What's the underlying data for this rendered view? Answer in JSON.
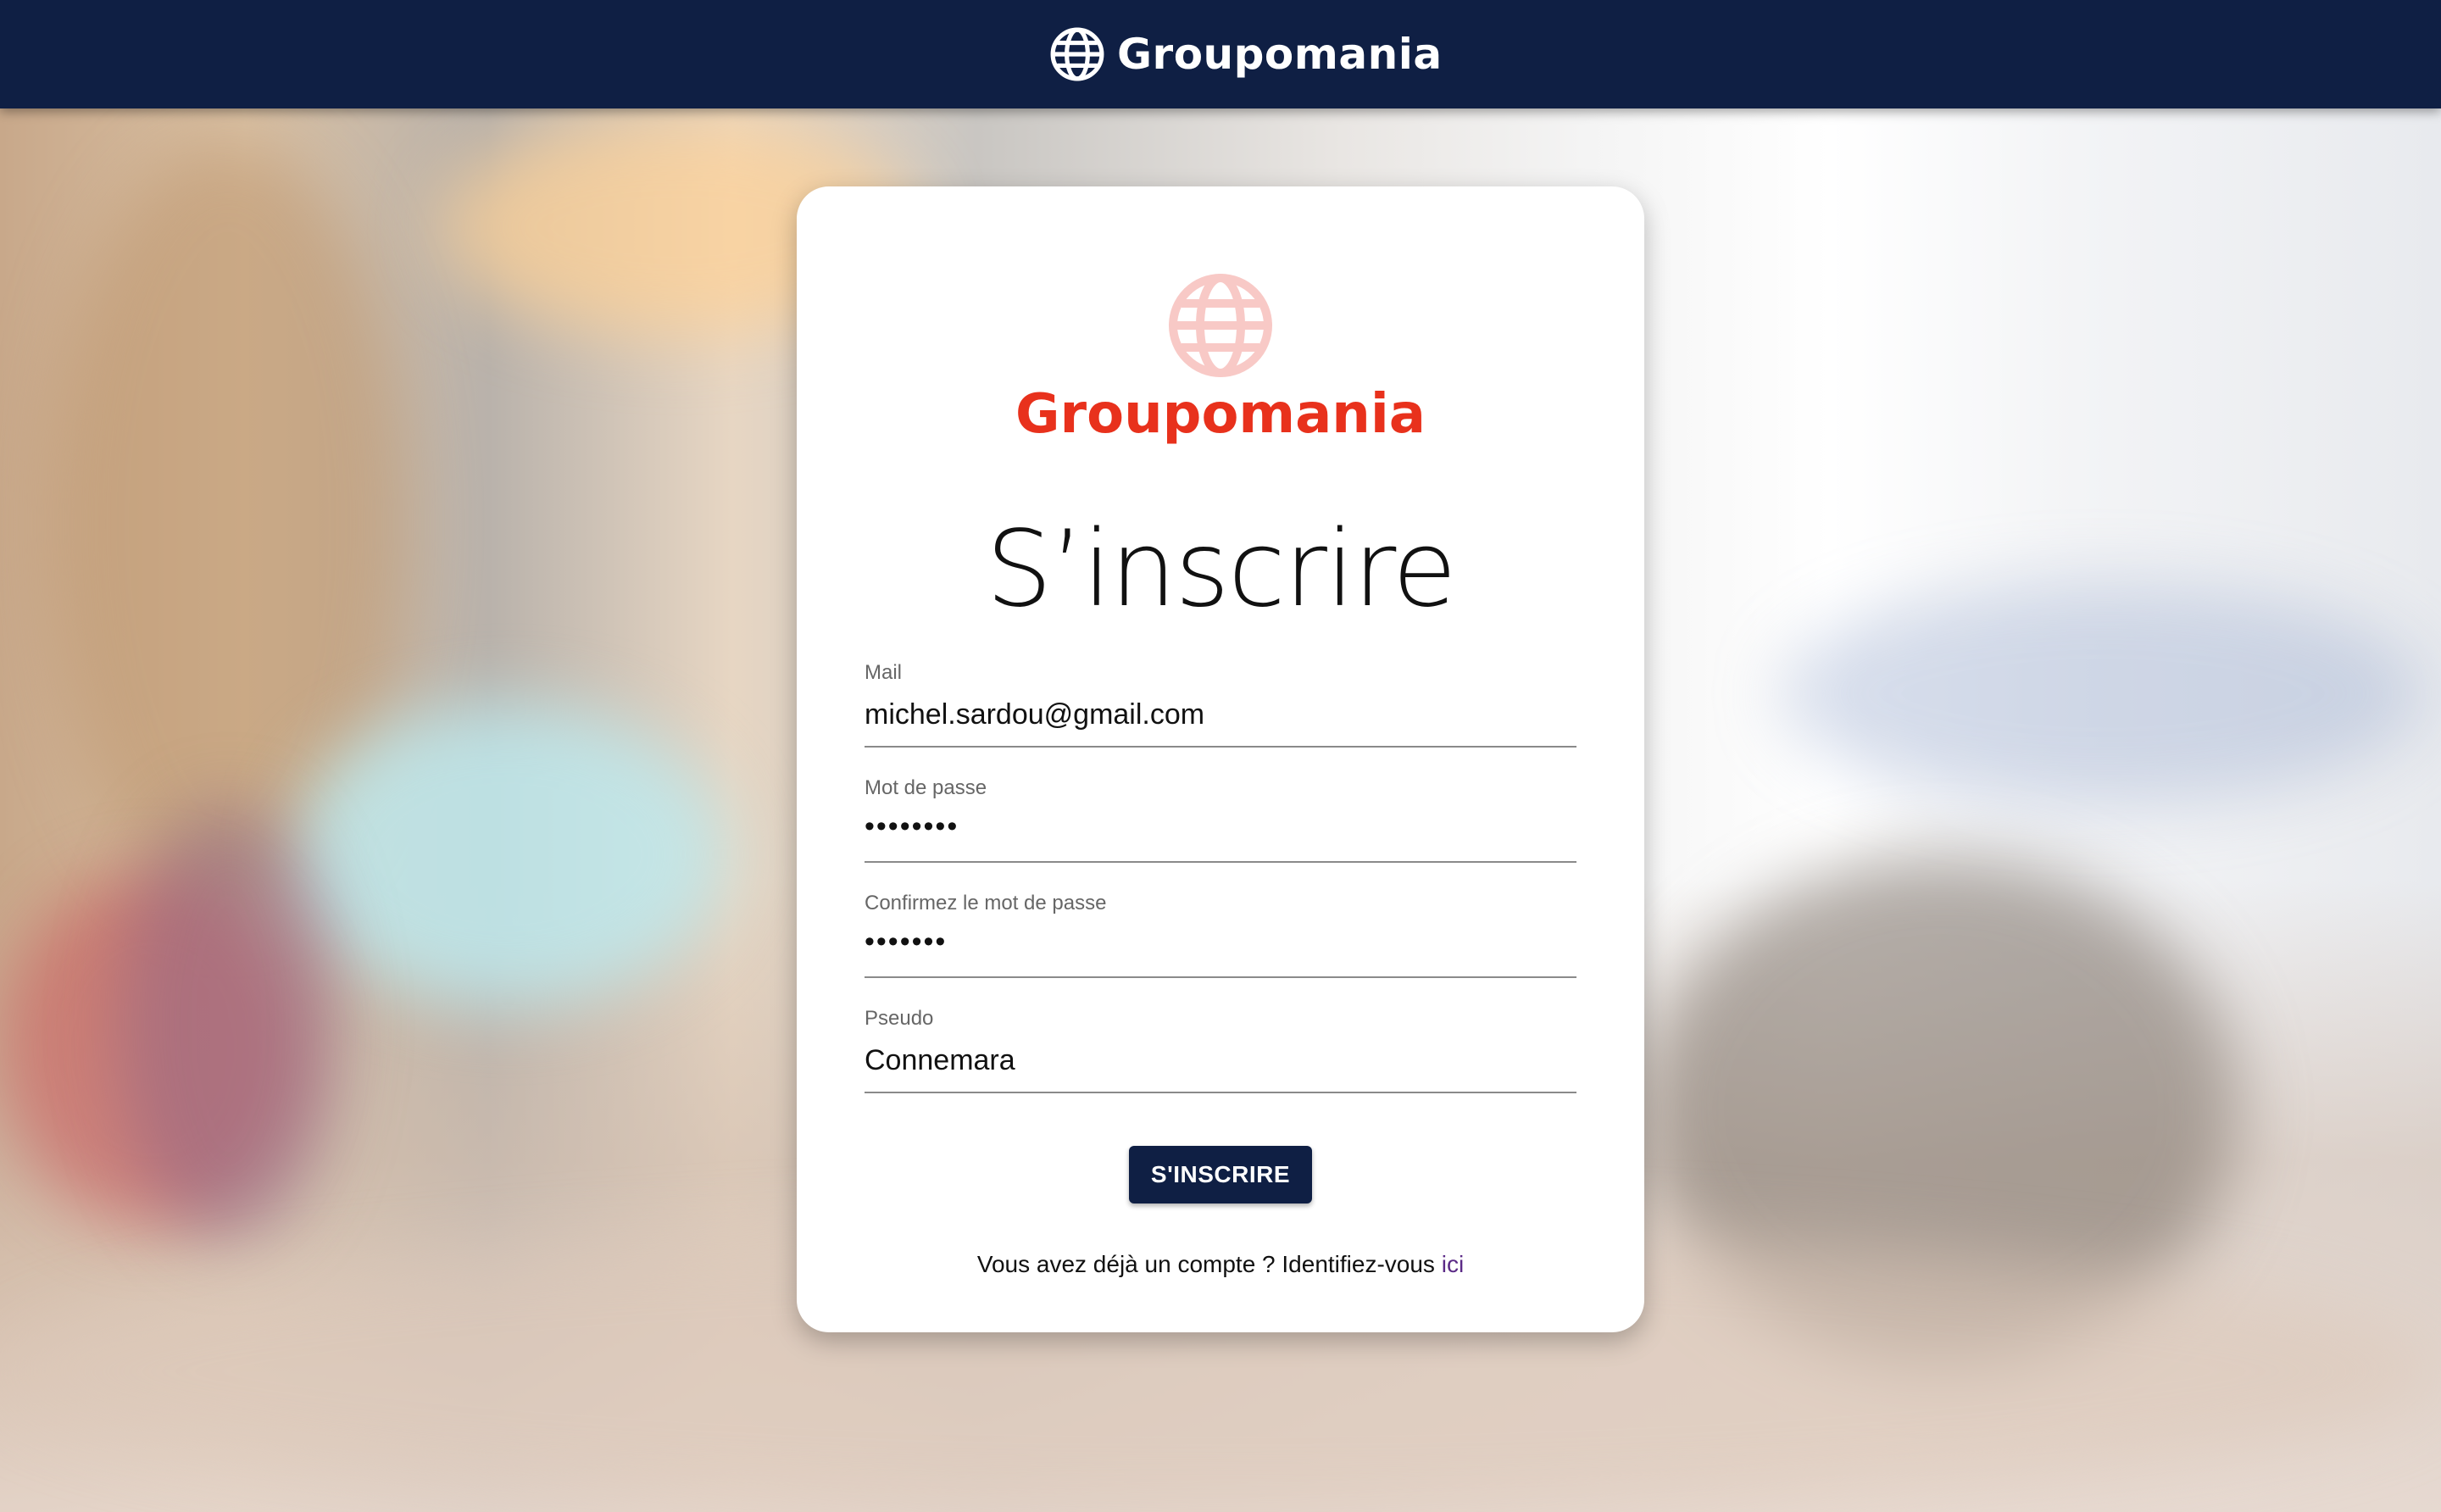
{
  "header": {
    "brand": "Groupomania"
  },
  "card": {
    "logo_text": "Groupomania",
    "title": "S’inscrire",
    "fields": [
      {
        "label": "Mail",
        "value": "michel.sardou@gmail.com"
      },
      {
        "label": "Mot de passe",
        "value": "••••••••"
      },
      {
        "label": "Confirmez le mot de passe",
        "value": "•••••••"
      },
      {
        "label": "Pseudo",
        "value": "Connemara"
      }
    ],
    "submit_label": "S'INSCRIRE",
    "login_prompt": "Vous avez déjà un compte ? Identifiez-vous",
    "login_link": "ici"
  },
  "colors": {
    "navy": "#0f1f44",
    "brand_red": "#e8311c",
    "globe_pink": "#f8c9c6",
    "link_purple": "#5b2a86"
  },
  "icons": {
    "header_logo": "globe-icon",
    "card_logo": "globe-icon"
  }
}
